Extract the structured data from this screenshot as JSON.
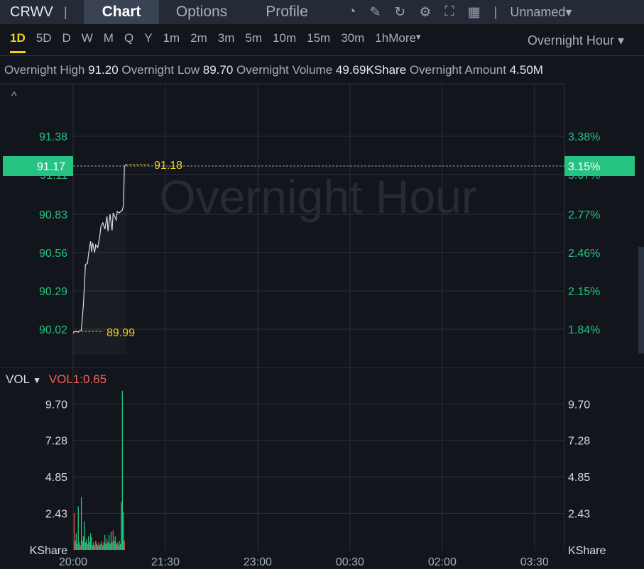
{
  "header": {
    "ticker": "CRWV",
    "tabs": [
      "Chart",
      "Options",
      "Profile"
    ],
    "active_tab": "Chart",
    "layout_name": "Unnamed",
    "icons": [
      "indicator-icon",
      "draw-icon",
      "refresh-icon",
      "settings-icon",
      "fullscreen-icon",
      "layout-grid-icon"
    ]
  },
  "periods": {
    "items": [
      "1D",
      "5D",
      "D",
      "W",
      "M",
      "Q",
      "Y",
      "1m",
      "2m",
      "3m",
      "5m",
      "10m",
      "15m",
      "30m",
      "1h",
      "More"
    ],
    "active": "1D",
    "session": "Overnight Hour"
  },
  "stats": {
    "high_label": "Overnight High",
    "high": "91.20",
    "low_label": "Overnight Low",
    "low": "89.70",
    "vol_label": "Overnight Volume",
    "vol": "49.69KShare",
    "amt_label": "Overnight Amount",
    "amt": "4.50M"
  },
  "watermark": "Overnight Hour",
  "colors": {
    "up": "#26c281",
    "down": "#e0524d",
    "accent": "#f2d014",
    "bg": "#12151b"
  },
  "chart_data": {
    "type": "line",
    "price": {
      "y_ticks": [
        "91.38",
        "91.11",
        "90.83",
        "90.56",
        "90.29",
        "90.02"
      ],
      "y_tick_values": [
        91.38,
        91.11,
        90.83,
        90.56,
        90.29,
        90.02
      ],
      "pct_ticks": [
        "3.38%",
        "3.07%",
        "2.77%",
        "2.46%",
        "2.15%",
        "1.84%"
      ],
      "current_price": "91.17",
      "current_pct": "3.15%",
      "current_value": 91.17,
      "max_label": "91.18",
      "max_value": 91.18,
      "min_label": "89.99",
      "min_value": 89.99,
      "minutes": [
        0,
        1,
        5,
        8,
        10,
        12,
        14,
        15,
        17,
        18,
        19,
        21,
        22,
        24,
        26,
        27,
        29,
        31,
        33,
        34,
        36,
        38,
        39,
        42,
        43,
        45,
        48,
        49,
        50,
        52
      ],
      "values": [
        89.99,
        90.005,
        90.0,
        90.015,
        90.19,
        90.475,
        90.485,
        90.55,
        90.64,
        90.565,
        90.63,
        90.56,
        90.615,
        90.595,
        90.675,
        90.74,
        90.77,
        90.725,
        90.815,
        90.71,
        90.83,
        90.715,
        90.84,
        90.79,
        90.85,
        90.84,
        90.86,
        90.89,
        91.17,
        91.18
      ]
    },
    "volume": {
      "label": "VOL",
      "indicator": "VOL1:0.65",
      "unit": "KShare",
      "y_ticks": [
        "9.70",
        "7.28",
        "4.85",
        "2.43"
      ],
      "y_tick_values": [
        9.7,
        7.28,
        4.85,
        2.43
      ],
      "bars": [
        [
          1,
          2.45,
          "d"
        ],
        [
          2,
          0.6,
          "u"
        ],
        [
          3,
          1.1,
          "u"
        ],
        [
          4,
          0.4,
          "d"
        ],
        [
          5,
          2.9,
          "u"
        ],
        [
          6,
          0.5,
          "u"
        ],
        [
          7,
          0.3,
          "d"
        ],
        [
          8,
          3.5,
          "u"
        ],
        [
          9,
          0.6,
          "u"
        ],
        [
          10,
          0.9,
          "u"
        ],
        [
          11,
          1.9,
          "u"
        ],
        [
          12,
          0.5,
          "u"
        ],
        [
          13,
          0.7,
          "u"
        ],
        [
          14,
          0.4,
          "d"
        ],
        [
          15,
          0.9,
          "u"
        ],
        [
          16,
          0.5,
          "u"
        ],
        [
          17,
          1.1,
          "u"
        ],
        [
          18,
          0.85,
          "d"
        ],
        [
          19,
          0.3,
          "u"
        ],
        [
          20,
          0.5,
          "u"
        ],
        [
          21,
          0.3,
          "d"
        ],
        [
          22,
          0.6,
          "d"
        ],
        [
          23,
          0.4,
          "u"
        ],
        [
          24,
          0.3,
          "u"
        ],
        [
          25,
          0.5,
          "d"
        ],
        [
          26,
          0.3,
          "u"
        ],
        [
          27,
          0.4,
          "u"
        ],
        [
          28,
          0.6,
          "d"
        ],
        [
          29,
          0.3,
          "u"
        ],
        [
          30,
          0.5,
          "u"
        ],
        [
          31,
          1.0,
          "u"
        ],
        [
          32,
          0.4,
          "u"
        ],
        [
          33,
          0.7,
          "d"
        ],
        [
          34,
          0.5,
          "u"
        ],
        [
          35,
          1.0,
          "u"
        ],
        [
          36,
          0.4,
          "u"
        ],
        [
          37,
          1.2,
          "u"
        ],
        [
          38,
          0.5,
          "u"
        ],
        [
          39,
          1.3,
          "d"
        ],
        [
          40,
          0.6,
          "u"
        ],
        [
          41,
          0.9,
          "u"
        ],
        [
          42,
          0.4,
          "d"
        ],
        [
          43,
          0.5,
          "u"
        ],
        [
          44,
          0.3,
          "u"
        ],
        [
          45,
          0.6,
          "u"
        ],
        [
          46,
          0.4,
          "u"
        ],
        [
          47,
          3.2,
          "u"
        ],
        [
          48,
          10.57,
          "u"
        ],
        [
          49,
          2.5,
          "u"
        ],
        [
          50,
          0.6,
          "d"
        ]
      ]
    },
    "x_ticks": [
      "20:00",
      "21:30",
      "23:00",
      "00:30",
      "02:00",
      "03:30"
    ],
    "x_tick_minutes": [
      0,
      90,
      180,
      270,
      360,
      450
    ]
  }
}
